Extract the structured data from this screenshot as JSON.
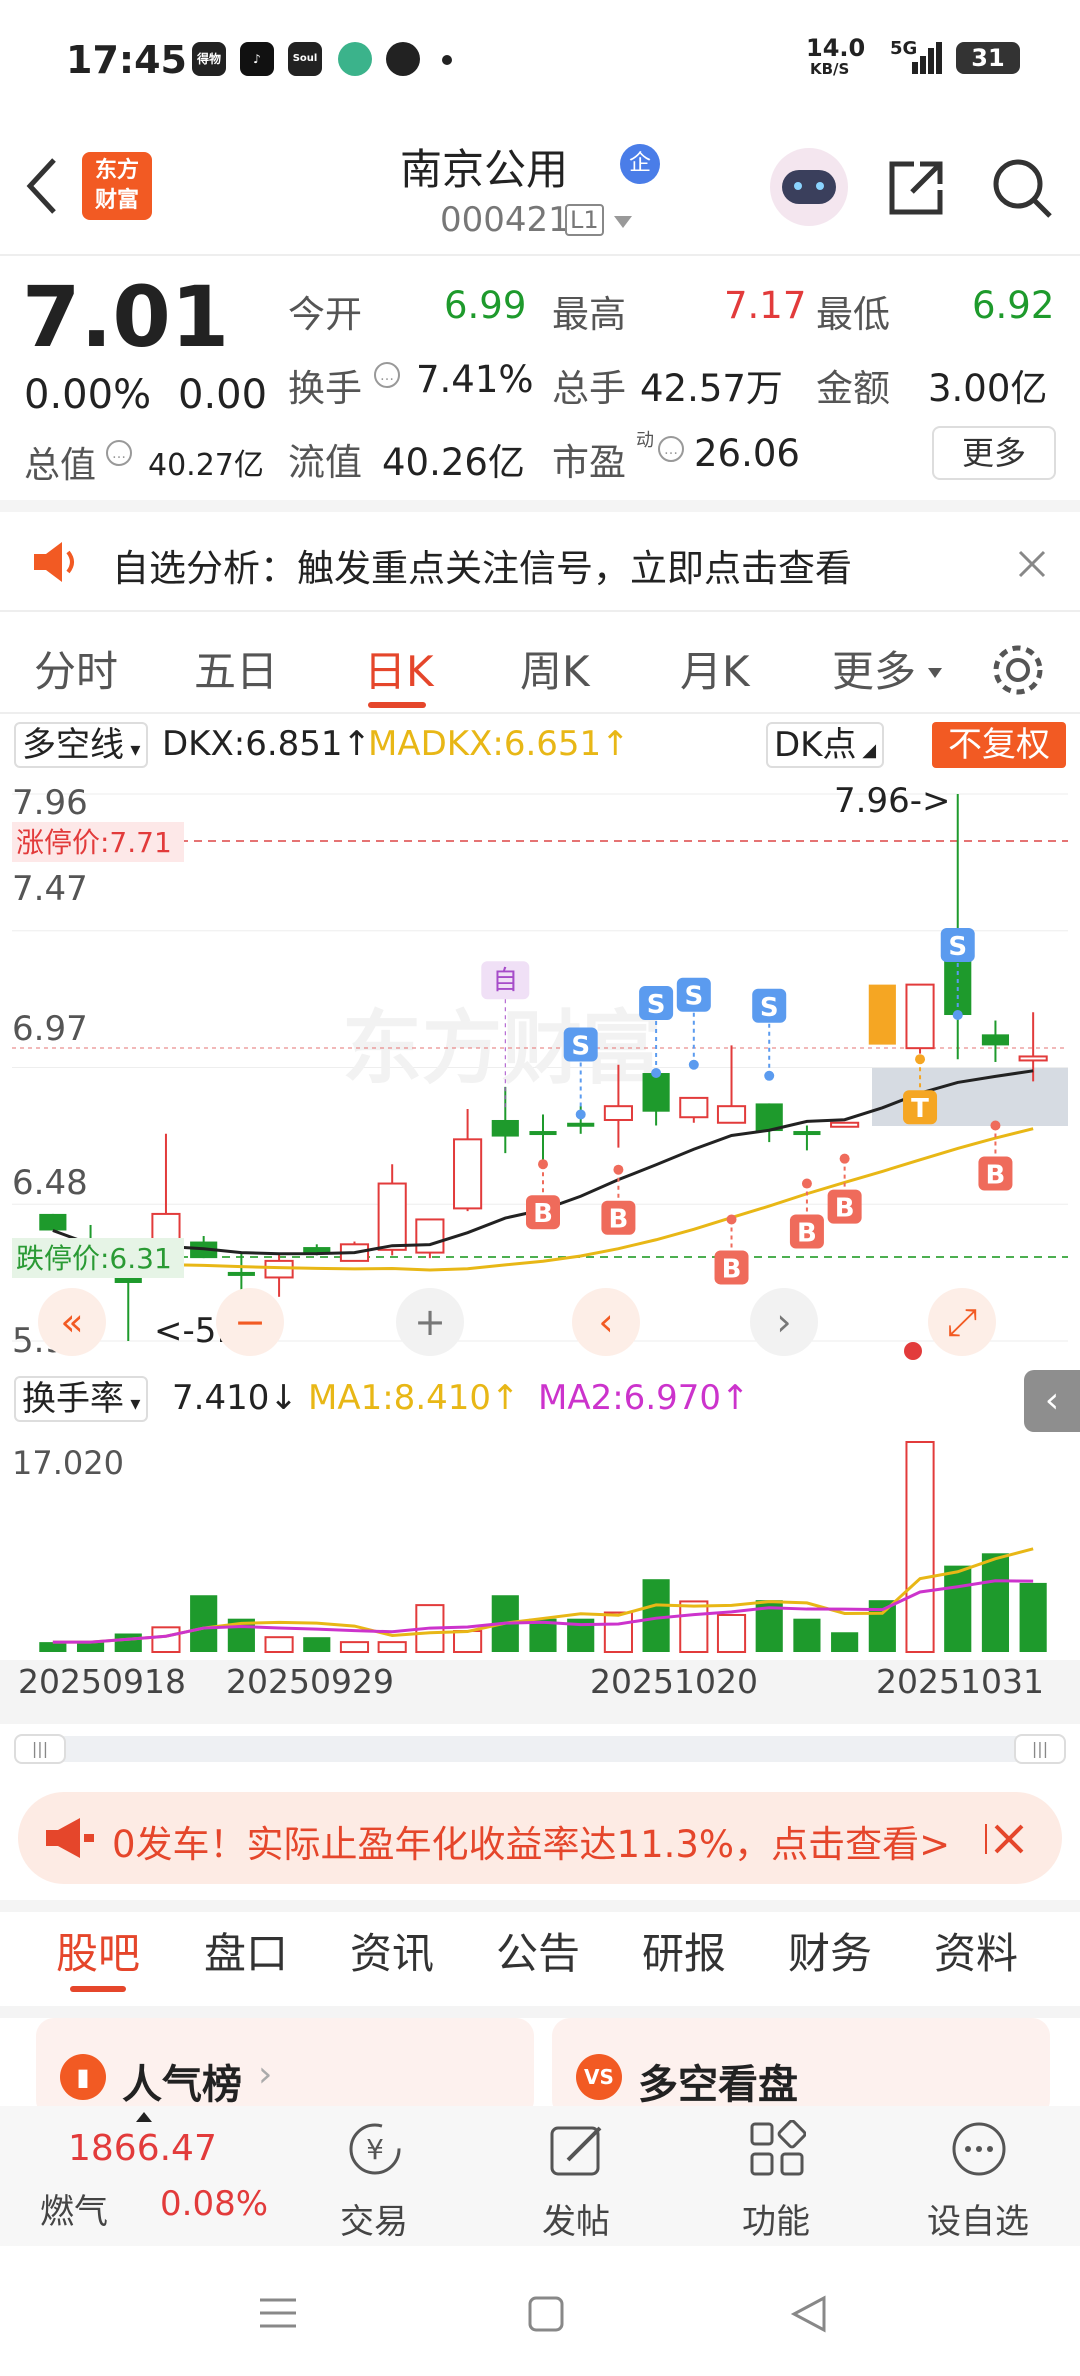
{
  "status_bar": {
    "time": "17:45",
    "net_speed": "14.0",
    "net_unit": "KB/S",
    "network": "5G",
    "battery": "31",
    "apps": [
      {
        "label": "得物"
      },
      {
        "label": "♪"
      },
      {
        "label": "Soul"
      },
      {
        "label": ""
      },
      {
        "label": ""
      }
    ]
  },
  "header": {
    "logo_line1": "东方",
    "logo_line2": "财富",
    "stock_name": "南京公用",
    "badge": "企",
    "stock_code": "000421",
    "level": "L1"
  },
  "quote": {
    "price": "7.01",
    "change_pct": "0.00%",
    "change": "0.00",
    "open_label": "今开",
    "open": "6.99",
    "high_label": "最高",
    "high": "7.17",
    "low_label": "最低",
    "low": "6.92",
    "turnover_label": "换手",
    "turnover": "7.41%",
    "volume_label": "总手",
    "volume": "42.57万",
    "amount_label": "金额",
    "amount": "3.00亿",
    "mktcap_label": "总值",
    "mktcap": "40.27亿",
    "float_label": "流值",
    "float_cap": "40.26亿",
    "pe_label": "市盈",
    "pe_sup": "动",
    "pe": "26.06",
    "more": "更多"
  },
  "alert": {
    "text": "自选分析：触发重点关注信号，立即点击查看"
  },
  "chart_tabs": [
    {
      "label": "分时"
    },
    {
      "label": "五日"
    },
    {
      "label": "日K"
    },
    {
      "label": "周K"
    },
    {
      "label": "月K"
    },
    {
      "label": "更多"
    }
  ],
  "indicator_bar": {
    "selector": "多空线",
    "dkx": "DKX:6.851↑",
    "madkx": "MADKX:6.651↑",
    "dk_point": "DK点",
    "adjust": "不复权"
  },
  "chart_labels": {
    "high_marker": "7.96->",
    "low_marker": "<-5.98",
    "limit_up": "涨停价:7.71",
    "limit_down": "跌停价:6.31",
    "y_ticks": [
      "7.96",
      "7.47",
      "6.97",
      "6.48",
      "5.98"
    ],
    "self_marker": "自",
    "watermark": "东方财富"
  },
  "volume_bar": {
    "selector": "换手率",
    "value": "7.410↓",
    "ma1": "MA1:8.410↑",
    "ma2": "MA2:6.970↑",
    "ytop": "17.020",
    "dates": [
      "20250918",
      "20250929",
      "20251020",
      "20251031"
    ]
  },
  "promo": {
    "text": "0发车！实际止盈年化收益率达11.3%，点击查看>"
  },
  "bottom_tabs": [
    {
      "label": "股吧"
    },
    {
      "label": "盘口"
    },
    {
      "label": "资讯"
    },
    {
      "label": "公告"
    },
    {
      "label": "研报"
    },
    {
      "label": "财务"
    },
    {
      "label": "资料"
    }
  ],
  "cards": {
    "left": "人气榜",
    "right": "多空看盘"
  },
  "bottom_nav": {
    "index_value": "1866.47",
    "index_name": "燃气",
    "index_change": "0.08%",
    "trade": "交易",
    "post": "发帖",
    "func": "功能",
    "watch": "设自选"
  },
  "chart_data": {
    "type": "candlestick",
    "ylim": [
      5.98,
      7.96
    ],
    "dates_labeled": [
      "20250918",
      "20250929",
      "20251020",
      "20251031"
    ],
    "candles": [
      {
        "o": 6.44,
        "c": 6.38,
        "h": 6.44,
        "l": 6.38
      },
      {
        "o": 6.33,
        "c": 6.28,
        "h": 6.4,
        "l": 6.25
      },
      {
        "o": 6.24,
        "c": 6.19,
        "h": 6.31,
        "l": 5.98
      },
      {
        "o": 6.22,
        "c": 6.44,
        "h": 6.73,
        "l": 6.21
      },
      {
        "o": 6.34,
        "c": 6.28,
        "h": 6.36,
        "l": 6.28
      },
      {
        "o": 6.23,
        "c": 6.23,
        "h": 6.3,
        "l": 6.15
      },
      {
        "o": 6.21,
        "c": 6.27,
        "h": 6.3,
        "l": 6.14
      },
      {
        "o": 6.32,
        "c": 6.3,
        "h": 6.33,
        "l": 6.29
      },
      {
        "o": 6.27,
        "c": 6.33,
        "h": 6.34,
        "l": 6.27
      },
      {
        "o": 6.31,
        "c": 6.55,
        "h": 6.62,
        "l": 6.29
      },
      {
        "o": 6.3,
        "c": 6.42,
        "h": 6.42,
        "l": 6.28
      },
      {
        "o": 6.46,
        "c": 6.71,
        "h": 6.82,
        "l": 6.45
      },
      {
        "o": 6.78,
        "c": 6.72,
        "h": 6.9,
        "l": 6.66
      },
      {
        "o": 6.74,
        "c": 6.74,
        "h": 6.8,
        "l": 6.63
      },
      {
        "o": 6.77,
        "c": 6.77,
        "h": 6.83,
        "l": 6.73
      },
      {
        "o": 6.78,
        "c": 6.83,
        "h": 6.98,
        "l": 6.68
      },
      {
        "o": 6.95,
        "c": 6.81,
        "h": 6.96,
        "l": 6.76
      },
      {
        "o": 6.79,
        "c": 6.86,
        "h": 6.82,
        "l": 6.77
      },
      {
        "o": 6.77,
        "c": 6.83,
        "h": 7.05,
        "l": 6.77
      },
      {
        "o": 6.84,
        "c": 6.74,
        "h": 6.84,
        "l": 6.7
      },
      {
        "o": 6.74,
        "c": 6.74,
        "h": 6.76,
        "l": 6.67
      },
      {
        "o": 6.77,
        "c": 6.77,
        "h": 6.77,
        "l": 6.77
      },
      {
        "o": 7.15,
        "c": 7.15,
        "h": 7.15,
        "l": 7.15
      },
      {
        "o": 7.04,
        "c": 7.27,
        "h": 7.27,
        "l": 7.02
      },
      {
        "o": 7.36,
        "c": 7.16,
        "h": 7.96,
        "l": 7.0
      },
      {
        "o": 7.09,
        "c": 7.05,
        "h": 7.14,
        "l": 6.99
      },
      {
        "o": 7.01,
        "c": 7.01,
        "h": 7.17,
        "l": 6.92
      }
    ],
    "turnover": [
      0.8,
      0.8,
      1.5,
      2.0,
      4.6,
      2.7,
      1.2,
      1.2,
      0.8,
      0.8,
      3.8,
      1.7,
      4.6,
      2.7,
      2.7,
      3.2,
      5.9,
      4.1,
      3.0,
      4.2,
      2.7,
      1.6,
      4.2,
      17.02,
      7.0,
      8.0,
      5.6
    ]
  }
}
